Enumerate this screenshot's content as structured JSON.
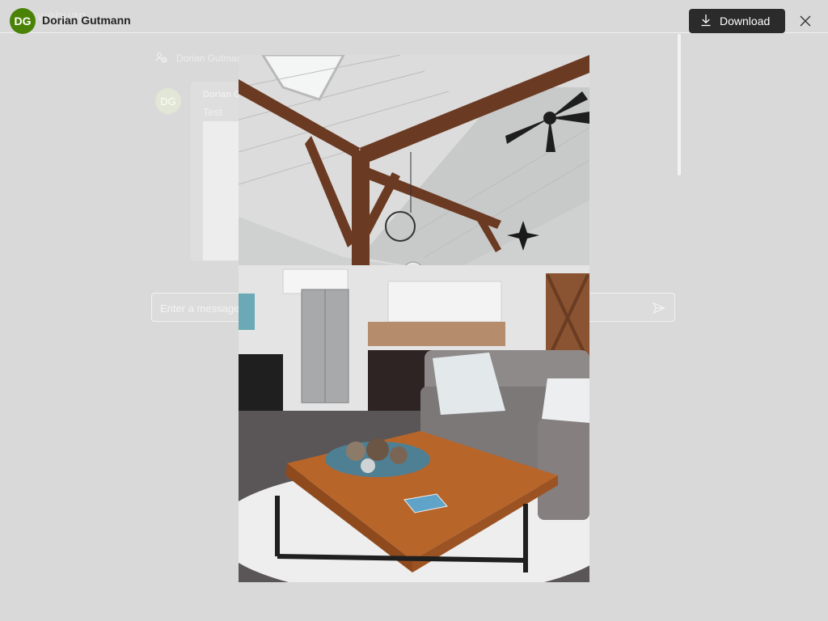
{
  "viewer": {
    "owner_initials": "DG",
    "owner_name": "Dorian Gutmann",
    "download_label": "Download",
    "photo_alt": "Living room with wooden beams, kitchen, sofa and coffee table",
    "colors": {
      "avatar": "#498205",
      "download_bg": "#2b2b2b"
    },
    "icons": {
      "download": "download-icon",
      "close": "close-icon"
    }
  },
  "background": {
    "brand_text": "webuan",
    "participants_label": "Dorian Gutman",
    "message": {
      "avatar_initials": "DG",
      "sender": "Dorian G",
      "text": "Test"
    },
    "composer": {
      "placeholder": "Enter a message"
    }
  }
}
